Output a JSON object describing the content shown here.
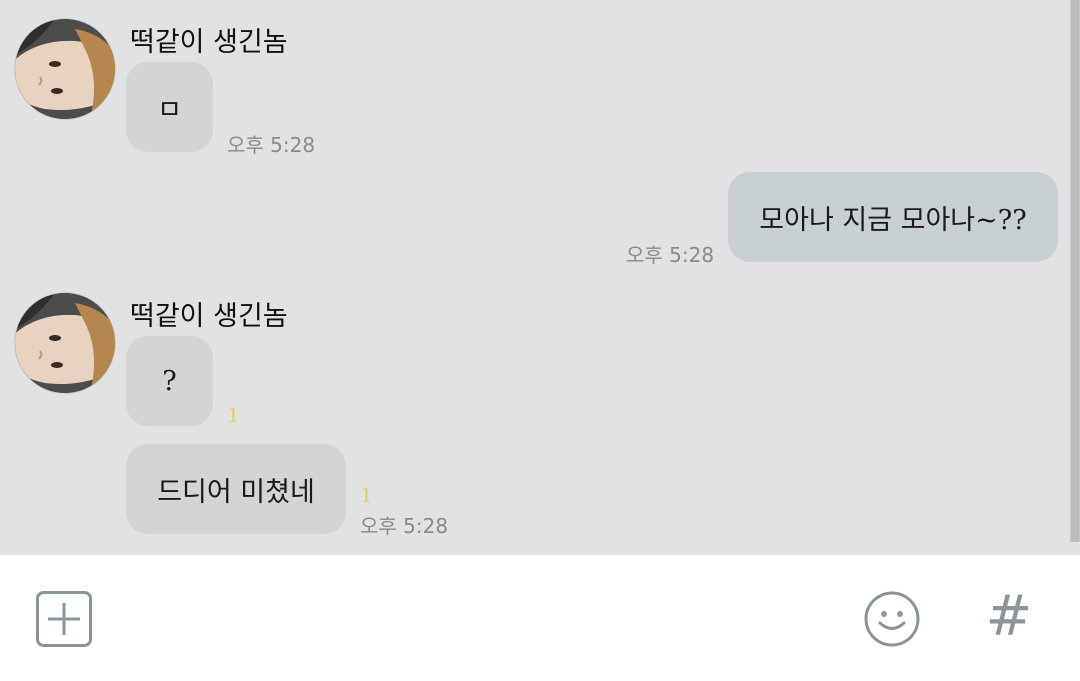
{
  "messages": [
    {
      "sender": "떡같이 생긴놈",
      "direction": "incoming",
      "text": "ㅁ",
      "time": "오후 5:28"
    },
    {
      "direction": "outgoing",
      "text": "모아나 지금 모아나~??",
      "time": "오후 5:28"
    },
    {
      "sender": "떡같이 생긴놈",
      "direction": "incoming",
      "text": "?",
      "unread": "1"
    },
    {
      "direction": "incoming",
      "text": "드디어 미쳤네",
      "unread": "1",
      "time": "오후 5:28"
    }
  ],
  "input_bar": {
    "icons": [
      "plus-square-icon",
      "smiley-icon",
      "hashtag-icon"
    ],
    "hashtag_glyph": "#"
  },
  "colors": {
    "chat_background": "#e2e2e2",
    "incoming_bubble": "#d4d4d4",
    "outgoing_bubble": "#c8d0d3",
    "unread_count": "#e0cf4d",
    "timestamp": "#8a8a8a",
    "icon": "#8b9499"
  }
}
